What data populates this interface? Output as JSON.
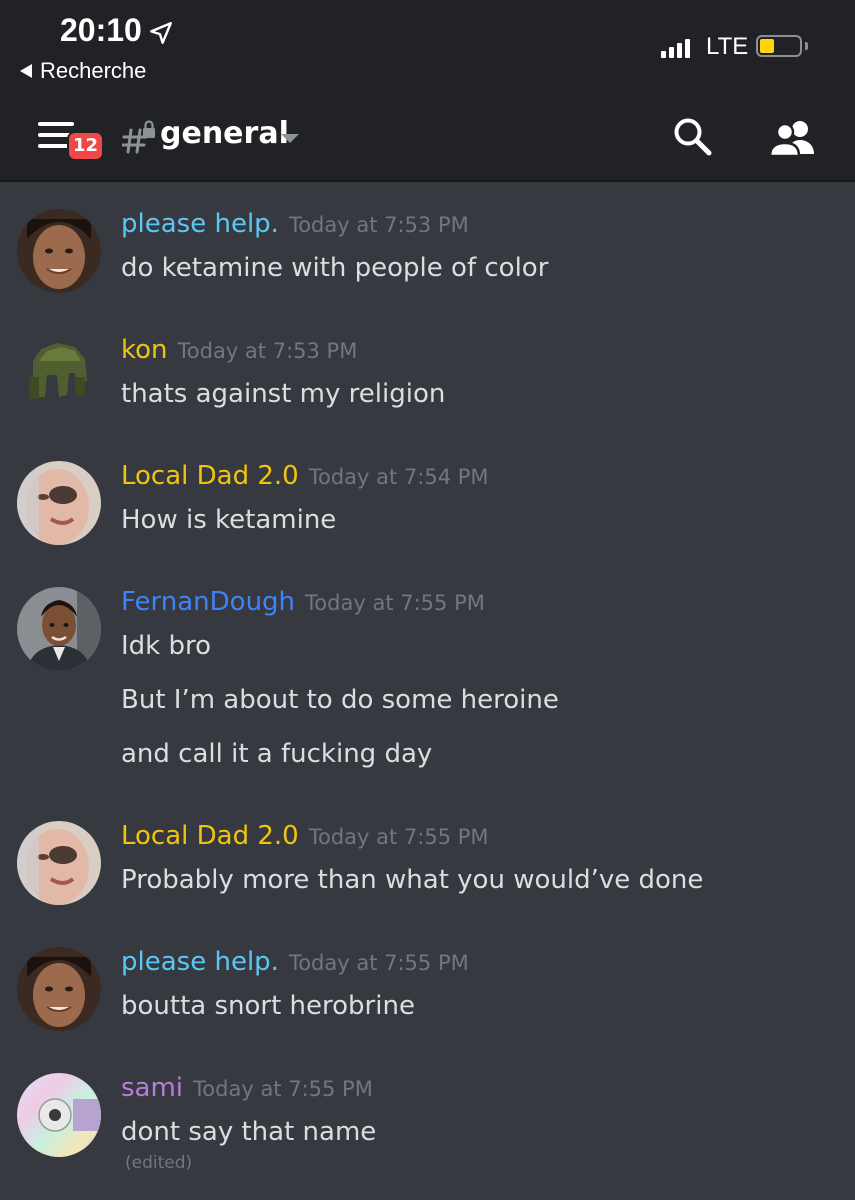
{
  "status_bar": {
    "time": "20:10",
    "back_label": "Recherche",
    "network": "LTE"
  },
  "header": {
    "unread_badge": "12",
    "channel": "general"
  },
  "messages": [
    {
      "author": "please help.",
      "author_color": "#5cc7f5",
      "timestamp": "Today at 7:53 PM",
      "lines": [
        "do ketamine with people of color"
      ],
      "avatar": "avatar-photo-girl"
    },
    {
      "author": "kon",
      "author_color": "#f1c40f",
      "timestamp": "Today at 7:53 PM",
      "lines": [
        "thats against my religion"
      ],
      "avatar": "avatar-green-helmet"
    },
    {
      "author": "Local Dad 2.0",
      "author_color": "#f1c40f",
      "timestamp": "Today at 7:54 PM",
      "lines": [
        "How is ketamine"
      ],
      "avatar": "avatar-photo-face"
    },
    {
      "author": "FernanDough",
      "author_color": "#3f83f8",
      "timestamp": "Today at 7:55 PM",
      "lines": [
        "Idk bro",
        "But I’m about to do some heroine",
        "and call it a fucking day"
      ],
      "avatar": "avatar-photo-boy"
    },
    {
      "author": "Local Dad 2.0",
      "author_color": "#f1c40f",
      "timestamp": "Today at 7:55 PM",
      "lines": [
        "Probably more than what you would’ve done"
      ],
      "avatar": "avatar-photo-face"
    },
    {
      "author": "please help.",
      "author_color": "#5cc7f5",
      "timestamp": "Today at 7:55 PM",
      "lines": [
        "boutta snort herobrine"
      ],
      "avatar": "avatar-photo-girl"
    },
    {
      "author": "sami",
      "author_color": "#b57edc",
      "timestamp": "Today at 7:55 PM",
      "lines": [
        "dont say that name"
      ],
      "edited": "(edited)",
      "avatar": "avatar-cd-disc"
    }
  ]
}
